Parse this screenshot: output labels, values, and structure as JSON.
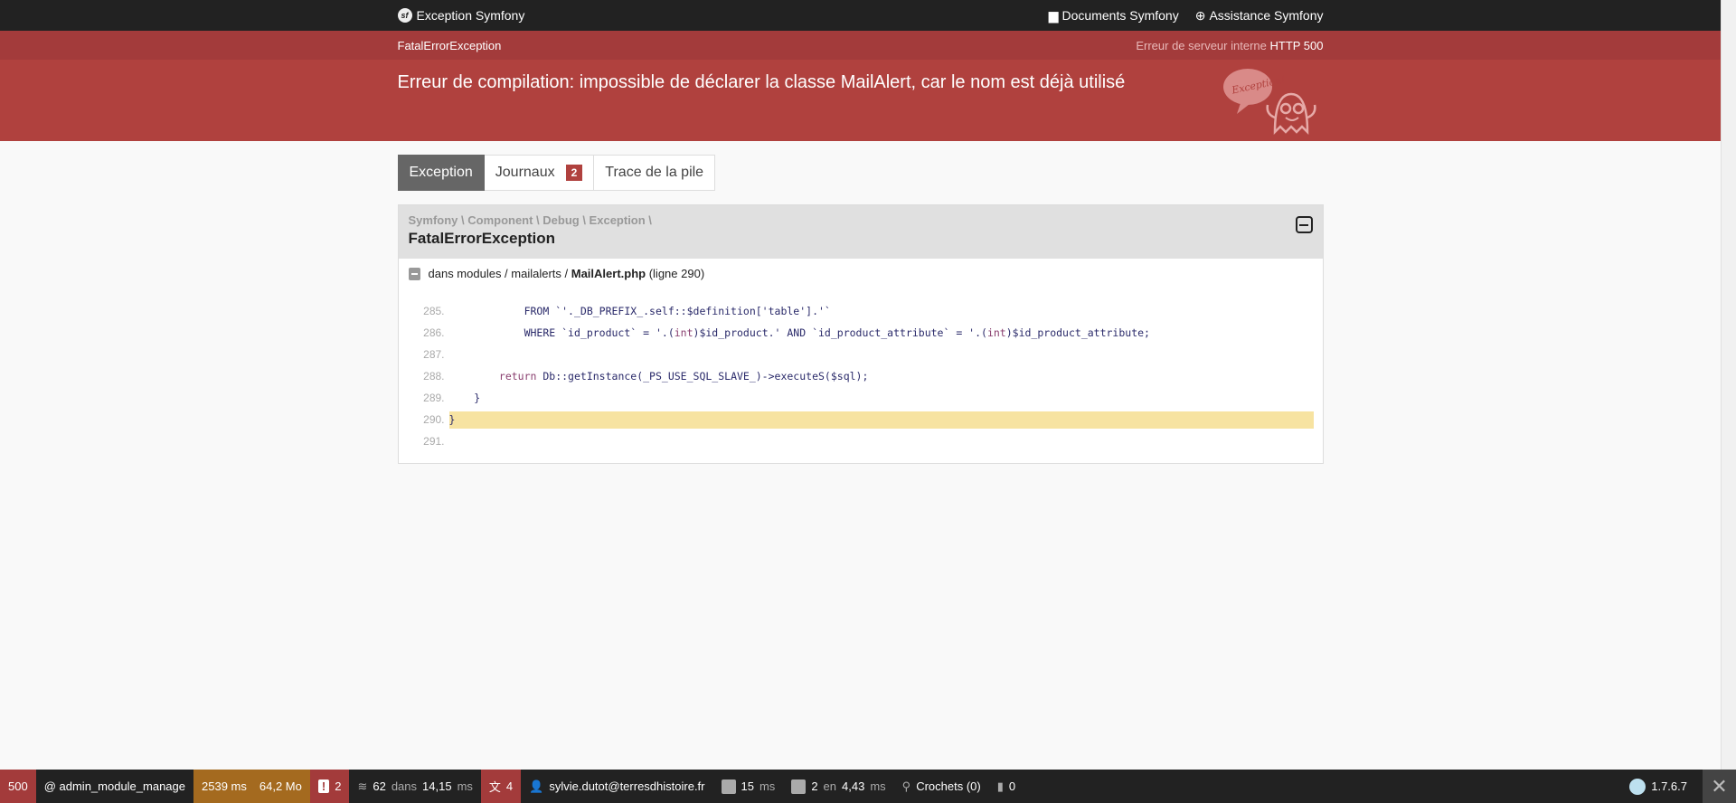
{
  "topbar": {
    "brand": "Exception Symfony",
    "docs": "Documents Symfony",
    "help": "Assistance Symfony",
    "logo_text": "sf"
  },
  "subbar": {
    "exception": "FatalErrorException",
    "status_label": "Erreur de serveur interne",
    "status_code": "HTTP 500"
  },
  "hero": {
    "message": "Erreur de compilation: impossible de déclarer la classe MailAlert, car le nom est déjà utilisé",
    "mascot_text": "Exception!"
  },
  "tabs": [
    {
      "label": "Exception"
    },
    {
      "label": "Journaux",
      "count": "2"
    },
    {
      "label": "Trace de la pile"
    }
  ],
  "exception": {
    "namespace": "Symfony \\ Component \\ Debug \\ Exception \\",
    "class": "FatalErrorException",
    "file_prefix": "dans modules / mailalerts /",
    "file_name": "MailAlert.php",
    "file_line": "(ligne 290)"
  },
  "code": [
    {
      "n": "285.",
      "text": "            FROM `'._DB_PREFIX_.self::$definition['table'].'`"
    },
    {
      "n": "286.",
      "text": "            WHERE `id_product` = '.(int)$id_product.' AND `id_product_attribute` = '.(int)$id_product_attribute;"
    },
    {
      "n": "287.",
      "text": ""
    },
    {
      "n": "288.",
      "text": "        return Db::getInstance(_PS_USE_SQL_SLAVE_)->executeS($sql);"
    },
    {
      "n": "289.",
      "text": "    }"
    },
    {
      "n": "290.",
      "text": "}"
    },
    {
      "n": "291.",
      "text": ""
    }
  ],
  "toolbar": {
    "status": "500",
    "route": "@ admin_module_manage",
    "time": "2539 ms",
    "memory": "64,2 Mo",
    "errors": "2",
    "doctrine_count": "62",
    "doctrine_in": "dans",
    "doctrine_time": "14,15",
    "ms": "ms",
    "translations": "4",
    "user": "sylvie.dutot@terresdhistoire.fr",
    "twig_time": "15",
    "cache_count": "2",
    "cache_in": "en",
    "cache_time": "4,43",
    "hooks": "Crochets (0)",
    "fuel": "0",
    "version": "1.7.6.7",
    "close": "✕"
  },
  "colors": {
    "dark": "#222222",
    "red": "#b0413e",
    "red_dark": "#a33b3b",
    "amber": "#a46a1f",
    "highlight": "#f7e3a1"
  }
}
